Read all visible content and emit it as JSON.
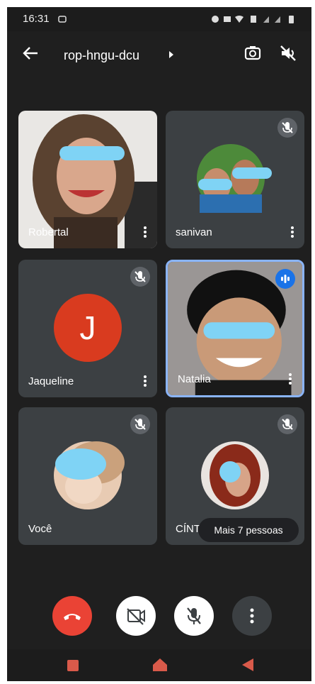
{
  "status_bar": {
    "time": "16:31"
  },
  "header": {
    "meeting_code": "rop-hngu-dcu"
  },
  "participants": [
    {
      "name": "Robertal"
    },
    {
      "name": "sanivan"
    },
    {
      "name": "Jaqueline",
      "initial": "J"
    },
    {
      "name": "Natalia"
    },
    {
      "name": "Você"
    },
    {
      "name": "CÍNT"
    }
  ],
  "overflow": {
    "label": "Mais 7 pessoas"
  },
  "colors": {
    "end_call": "#ea4335",
    "active_border": "#8ab4f8",
    "avatar_j": "#d93b1f"
  }
}
